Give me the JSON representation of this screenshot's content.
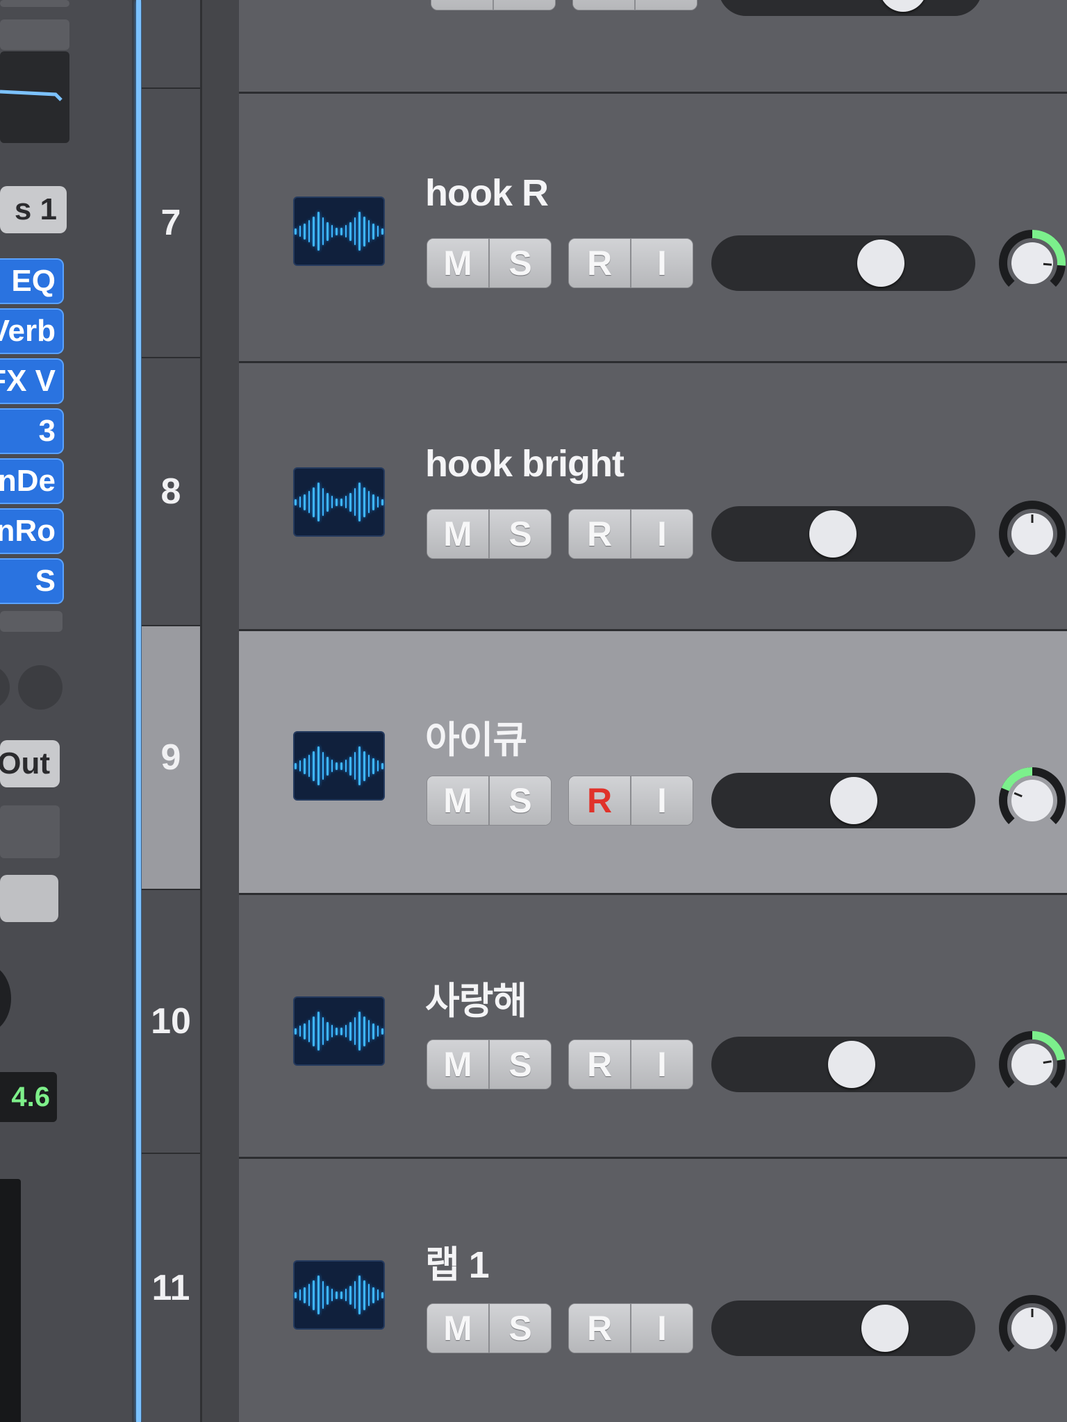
{
  "inspector": {
    "send_label": "s 1",
    "plugins": [
      "EQ",
      "Verb",
      "FX V",
      "3",
      "nDe",
      "nRo",
      "S"
    ],
    "output_label": "Out",
    "level_readout": "4.6"
  },
  "tracks": [
    {
      "number": "7",
      "name": "hook R",
      "mute": "M",
      "solo": "S",
      "record": "R",
      "input": "I",
      "record_armed": false,
      "selected": false,
      "volume": 0.68,
      "pan": 0.7
    },
    {
      "number": "8",
      "name": "hook bright",
      "mute": "M",
      "solo": "S",
      "record": "R",
      "input": "I",
      "record_armed": false,
      "selected": false,
      "volume": 0.45,
      "pan": 0.0
    },
    {
      "number": "9",
      "name": "아이큐",
      "mute": "M",
      "solo": "S",
      "record": "R",
      "input": "I",
      "record_armed": true,
      "selected": true,
      "volume": 0.55,
      "pan": -0.5
    },
    {
      "number": "10",
      "name": "사랑해",
      "mute": "M",
      "solo": "S",
      "record": "R",
      "input": "I",
      "record_armed": false,
      "selected": false,
      "volume": 0.54,
      "pan": 0.6
    },
    {
      "number": "11",
      "name": "랩 1",
      "mute": "M",
      "solo": "S",
      "record": "R",
      "input": "I",
      "record_armed": false,
      "selected": false,
      "volume": 0.7,
      "pan": 0.0
    }
  ],
  "colors": {
    "plugin_blue": "#2a73e0",
    "waveform": "#3fb6ff",
    "pan_ring": "#7cf08c",
    "record_active": "#e0322a"
  }
}
